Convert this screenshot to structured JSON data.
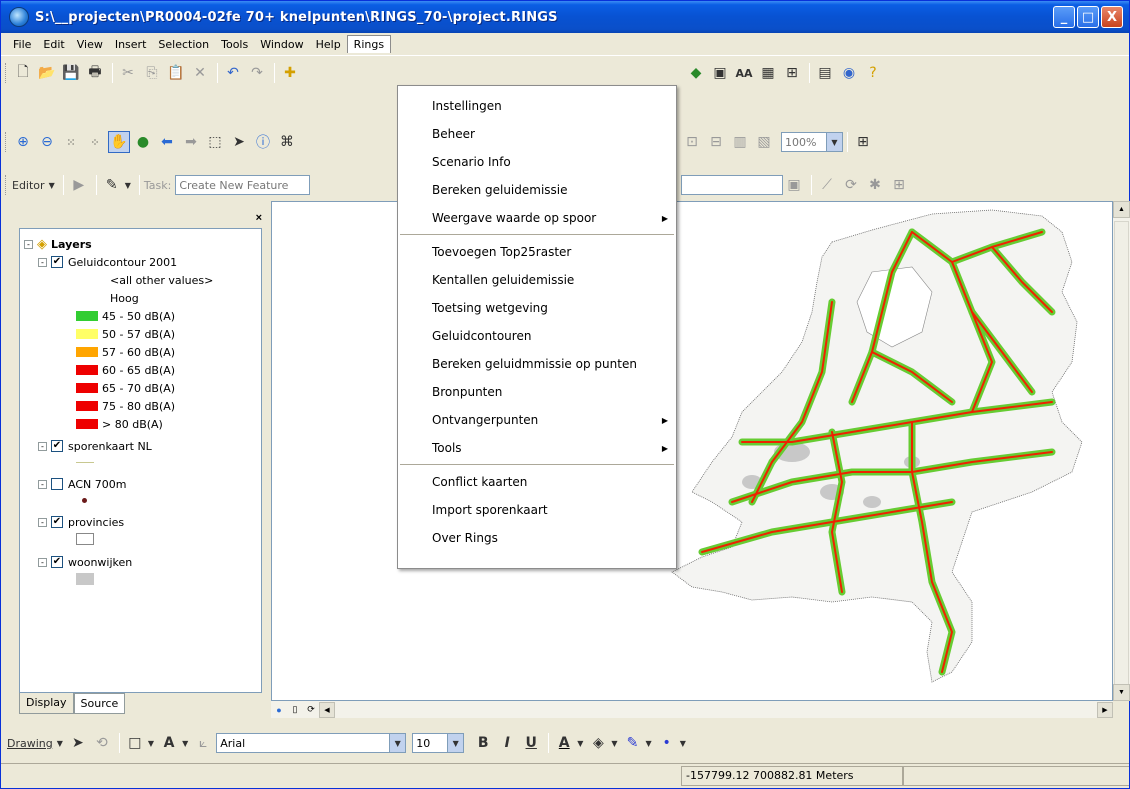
{
  "window": {
    "title": "S:\\__projecten\\PR0004-02fe 70+ knelpunten\\RINGS_70-\\project.RINGS",
    "controls": {
      "minimize": "_",
      "maximize": "□",
      "close": "X"
    }
  },
  "menubar": {
    "items": [
      "File",
      "Edit",
      "View",
      "Insert",
      "Selection",
      "Tools",
      "Window",
      "Help",
      "Rings"
    ]
  },
  "toolbar_editor": {
    "editor_label": "Editor",
    "task_label": "Task:",
    "task_value": "Create New Feature",
    "zoom_value": "100%"
  },
  "toc": {
    "root_label": "Layers",
    "layers": [
      {
        "name": "Geluidcontour 2001",
        "checked": "✔",
        "expander": "-"
      },
      {
        "name": "sporenkaart NL",
        "checked": "✔",
        "expander": "-"
      },
      {
        "name": "ACN 700m",
        "checked": "",
        "expander": "-"
      },
      {
        "name": "provincies",
        "checked": "✔",
        "expander": "-"
      },
      {
        "name": "woonwijken",
        "checked": "✔",
        "expander": "-"
      }
    ],
    "legend": [
      {
        "label": "<all other values>",
        "color": ""
      },
      {
        "label": "Hoog",
        "color": ""
      },
      {
        "label": "45 - 50 dB(A)",
        "color": "#32cd32"
      },
      {
        "label": "50 - 57 dB(A)",
        "color": "#ffff66"
      },
      {
        "label": "57 - 60 dB(A)",
        "color": "#ffa500"
      },
      {
        "label": "60 - 65 dB(A)",
        "color": "#ee0000"
      },
      {
        "label": "65 - 70 dB(A)",
        "color": "#ee0000"
      },
      {
        "label": "75 - 80 dB(A)",
        "color": "#ee0000"
      },
      {
        "label": "> 80 dB(A)",
        "color": "#ee0000"
      }
    ],
    "tabs": [
      "Display",
      "Source"
    ]
  },
  "rings_menu": {
    "group1": [
      {
        "label": "Instellingen",
        "submenu": false
      },
      {
        "label": "Beheer",
        "submenu": false
      },
      {
        "label": "Scenario Info",
        "submenu": false
      },
      {
        "label": "Bereken geluidemissie",
        "submenu": false
      },
      {
        "label": "Weergave waarde op spoor",
        "submenu": true
      }
    ],
    "group2": [
      {
        "label": "Toevoegen Top25raster",
        "submenu": false
      },
      {
        "label": "Kentallen geluidemissie",
        "submenu": false
      },
      {
        "label": "Toetsing wetgeving",
        "submenu": false
      },
      {
        "label": "Geluidcontouren",
        "submenu": false
      },
      {
        "label": "Bereken geluidmmissie op punten",
        "submenu": false
      },
      {
        "label": "Bronpunten",
        "submenu": false
      },
      {
        "label": "Ontvangerpunten",
        "submenu": true
      },
      {
        "label": "Tools",
        "submenu": true
      }
    ],
    "group3": [
      {
        "label": "Conflict kaarten",
        "submenu": false
      },
      {
        "label": "Import sporenkaart",
        "submenu": false
      },
      {
        "label": "Over Rings",
        "submenu": false
      }
    ]
  },
  "drawing_toolbar": {
    "drawing_label": "Drawing",
    "font_name": "Arial",
    "font_size": "10",
    "bold": "B",
    "italic": "I",
    "underline": "U"
  },
  "statusbar": {
    "coordinates": "-157799.12  700882.81 Meters"
  },
  "colors": {
    "titlebar": "#0852d2",
    "rail_green": "#66cc33",
    "rail_red": "#ee2200"
  }
}
